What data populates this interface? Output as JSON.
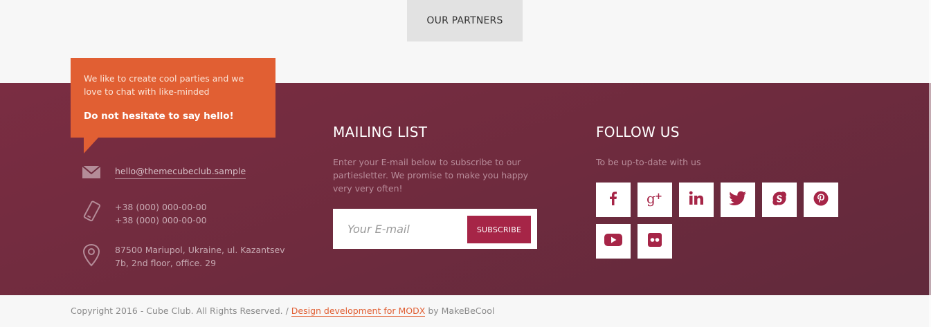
{
  "partners_tab": {
    "label": "OUR PARTNERS"
  },
  "contact": {
    "bubble_text": "We like to create cool parties and we love to chat with like-minded",
    "bubble_strong": "Do not hesitate to say hello!",
    "email": "hello@themecubeclub.sample",
    "phone_1": "+38 (000) 000-00-00",
    "phone_2": "+38 (000) 000-00-00",
    "address_line_1": "87500 Mariupol, Ukraine, ul. Kazantsev",
    "address_line_2": "7b, 2nd floor, office. 29",
    "icons": [
      "mail-icon",
      "phone-icon",
      "location-pin-icon"
    ]
  },
  "mailing": {
    "title": "MAILING LIST",
    "description": "Enter your E-mail below to subscribe to our partiesletter. We promise to make you happy very very often!",
    "placeholder": "Your E-mail",
    "button": "SUBSCRIBE"
  },
  "follow": {
    "title": "FOLLOW US",
    "description": "To be up-to-date with us",
    "networks": [
      "facebook",
      "google-plus",
      "linkedin",
      "twitter",
      "skype",
      "pinterest",
      "youtube",
      "flickr"
    ]
  },
  "footer": {
    "copyright": "Copyright 2016 - Cube Club. All Rights Reserved. /",
    "link_text": "Design development for MODX",
    "suffix": "by MakeBeCool"
  },
  "colors": {
    "accent_orange": "#e15f33",
    "footer_bg": "#6f2b3e",
    "subscribe_bg": "#a62547",
    "social_icon": "#a62547"
  }
}
